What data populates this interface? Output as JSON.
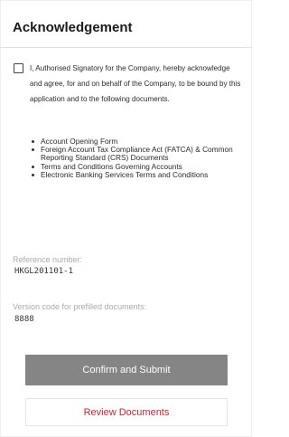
{
  "header": {
    "title": "Acknowledgement"
  },
  "acknowledgement": {
    "checked": false,
    "text": "I, Authorised Signatory for the Company, hereby acknowledge and agree, for and on behalf of the Company, to be bound by this application and to the following documents."
  },
  "documents": [
    "Account Opening Form",
    "Foreign Account Tax Compliance Act (FATCA) & Common Reporting Standard (CRS) Documents",
    "Terms and Conditions Governing Accounts",
    "Electronic Banking Services Terms and Conditions"
  ],
  "reference": {
    "label": "Reference number:",
    "value": "HKGL201101-1"
  },
  "version": {
    "label": "Version code for prefilled documents:",
    "value": "8888"
  },
  "actions": {
    "confirm_label": "Confirm and Submit",
    "review_label": "Review Documents"
  },
  "colors": {
    "confirm_button": "#858585",
    "review_text": "#c6213b",
    "field_label": "#aaaaaa"
  }
}
